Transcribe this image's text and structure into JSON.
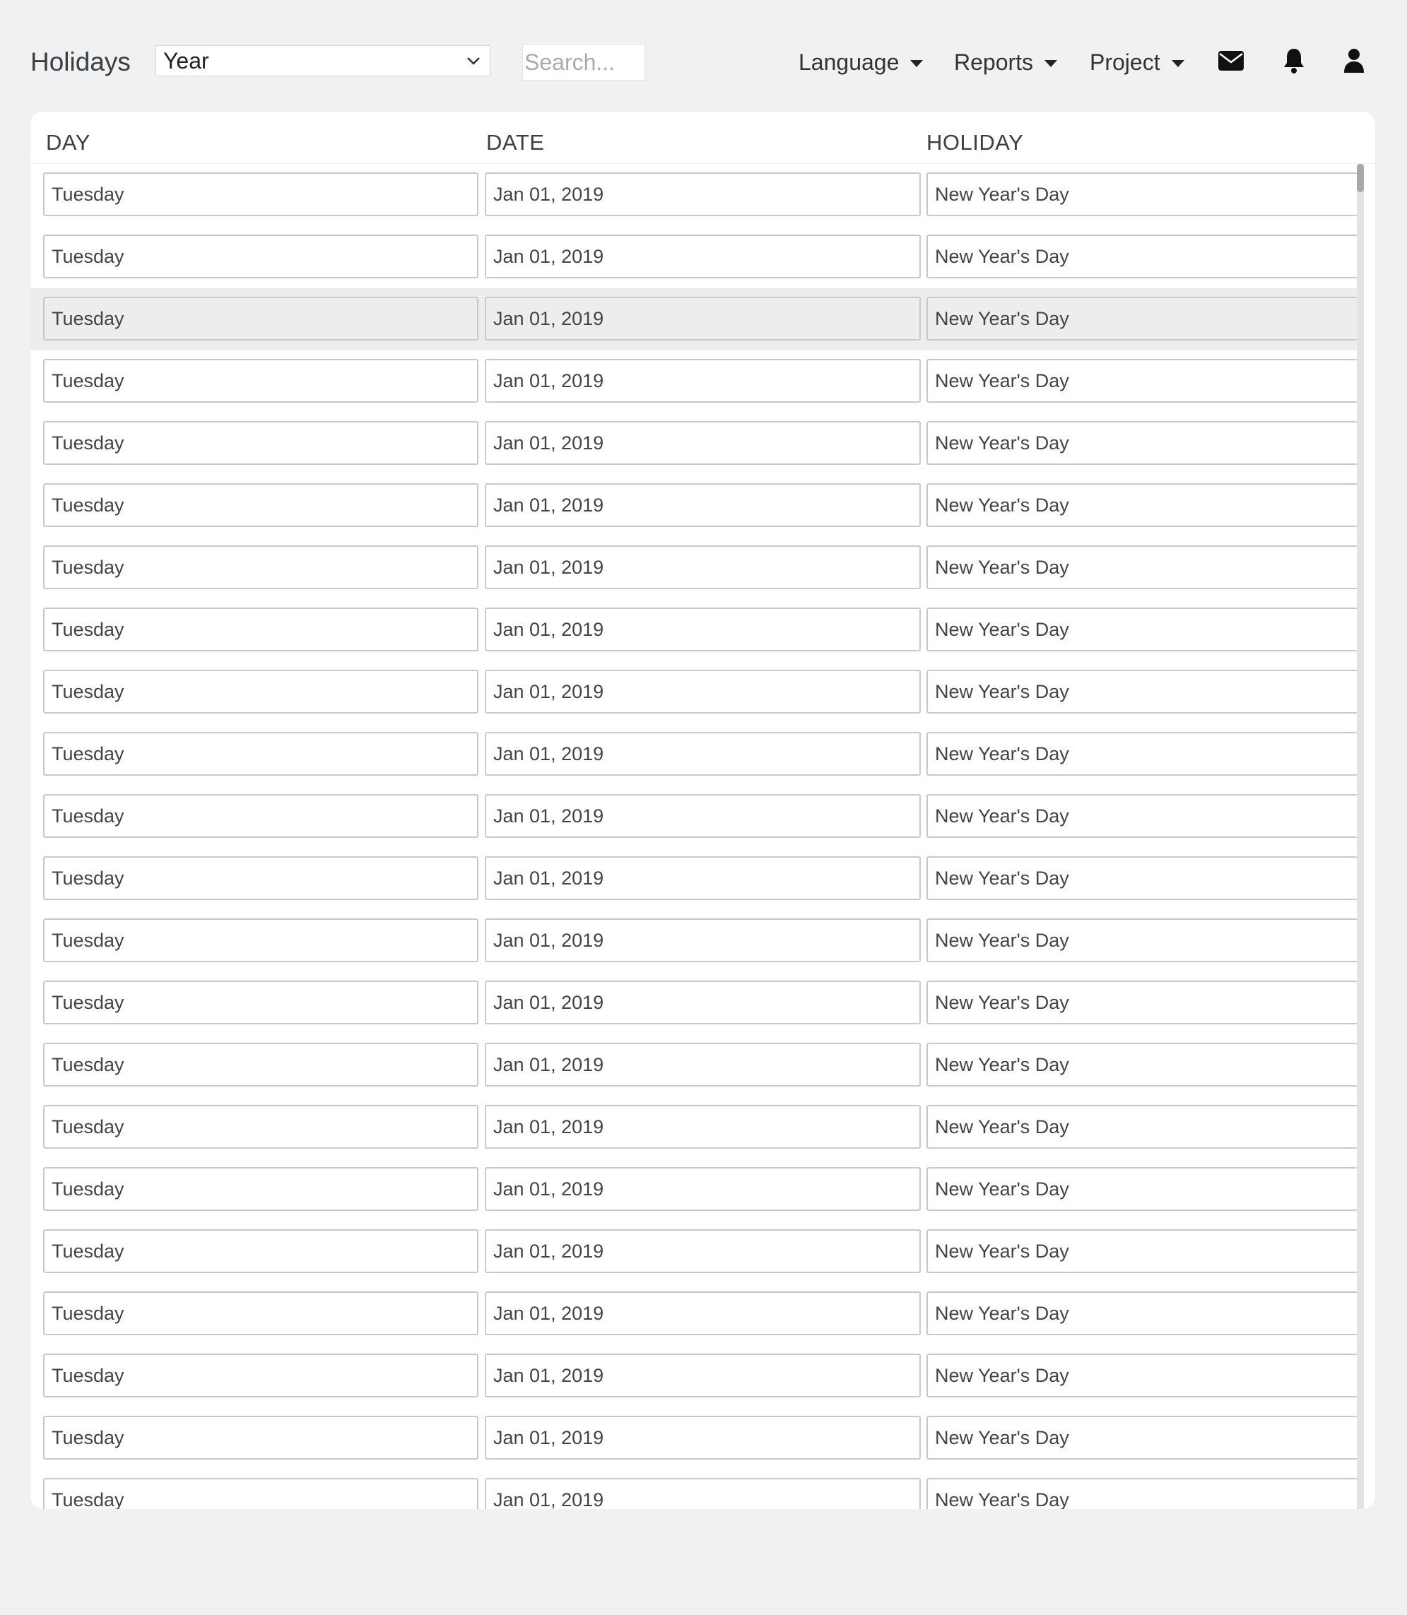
{
  "header": {
    "title": "Holidays",
    "year_select_value": "Year",
    "search_placeholder": "Search...",
    "menus": [
      {
        "label": "Language"
      },
      {
        "label": "Reports"
      },
      {
        "label": "Project"
      }
    ],
    "icons": [
      "envelope-icon",
      "bell-icon",
      "user-icon"
    ]
  },
  "table": {
    "columns": [
      "DAY",
      "DATE",
      "HOLIDAY"
    ],
    "highlighted_row_index": 2,
    "rows": [
      {
        "day": "Tuesday",
        "date": "Jan 01, 2019",
        "holiday": "New Year's Day"
      },
      {
        "day": "Tuesday",
        "date": "Jan 01, 2019",
        "holiday": "New Year's Day"
      },
      {
        "day": "Tuesday",
        "date": "Jan 01, 2019",
        "holiday": "New Year's Day"
      },
      {
        "day": "Tuesday",
        "date": "Jan 01, 2019",
        "holiday": "New Year's Day"
      },
      {
        "day": "Tuesday",
        "date": "Jan 01, 2019",
        "holiday": "New Year's Day"
      },
      {
        "day": "Tuesday",
        "date": "Jan 01, 2019",
        "holiday": "New Year's Day"
      },
      {
        "day": "Tuesday",
        "date": "Jan 01, 2019",
        "holiday": "New Year's Day"
      },
      {
        "day": "Tuesday",
        "date": "Jan 01, 2019",
        "holiday": "New Year's Day"
      },
      {
        "day": "Tuesday",
        "date": "Jan 01, 2019",
        "holiday": "New Year's Day"
      },
      {
        "day": "Tuesday",
        "date": "Jan 01, 2019",
        "holiday": "New Year's Day"
      },
      {
        "day": "Tuesday",
        "date": "Jan 01, 2019",
        "holiday": "New Year's Day"
      },
      {
        "day": "Tuesday",
        "date": "Jan 01, 2019",
        "holiday": "New Year's Day"
      },
      {
        "day": "Tuesday",
        "date": "Jan 01, 2019",
        "holiday": "New Year's Day"
      },
      {
        "day": "Tuesday",
        "date": "Jan 01, 2019",
        "holiday": "New Year's Day"
      },
      {
        "day": "Tuesday",
        "date": "Jan 01, 2019",
        "holiday": "New Year's Day"
      },
      {
        "day": "Tuesday",
        "date": "Jan 01, 2019",
        "holiday": "New Year's Day"
      },
      {
        "day": "Tuesday",
        "date": "Jan 01, 2019",
        "holiday": "New Year's Day"
      },
      {
        "day": "Tuesday",
        "date": "Jan 01, 2019",
        "holiday": "New Year's Day"
      },
      {
        "day": "Tuesday",
        "date": "Jan 01, 2019",
        "holiday": "New Year's Day"
      },
      {
        "day": "Tuesday",
        "date": "Jan 01, 2019",
        "holiday": "New Year's Day"
      },
      {
        "day": "Tuesday",
        "date": "Jan 01, 2019",
        "holiday": "New Year's Day"
      },
      {
        "day": "Tuesday",
        "date": "Jan 01, 2019",
        "holiday": "New Year's Day"
      }
    ]
  }
}
